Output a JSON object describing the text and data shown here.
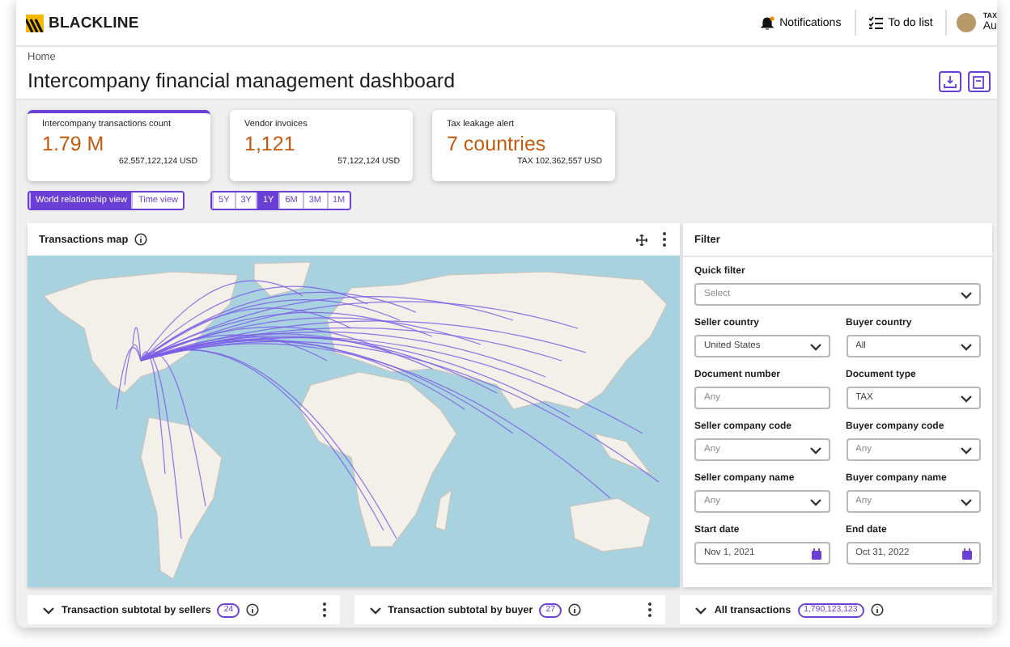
{
  "header": {
    "brand": "BLACKLINE",
    "notifications": "Notifications",
    "todo": "To do list",
    "user_role": "TAX",
    "user_name": "Au"
  },
  "breadcrumb": "Home",
  "title": "Intercompany financial management dashboard",
  "kpis": [
    {
      "label": "Intercompany transactions count",
      "value": "1.79 M",
      "sub": "62,557,122,124 USD",
      "selected": true
    },
    {
      "label": "Vendor invoices",
      "value": "1,121",
      "sub": "57,122,124 USD",
      "selected": false
    },
    {
      "label": "Tax leakage alert",
      "value": "7 countries",
      "sub": "TAX 102,362,557 USD",
      "selected": false
    }
  ],
  "views": [
    {
      "label": "World relationship view",
      "selected": true
    },
    {
      "label": "Time view",
      "selected": false
    }
  ],
  "ranges": [
    {
      "label": "5Y",
      "selected": false
    },
    {
      "label": "3Y",
      "selected": false
    },
    {
      "label": "1Y",
      "selected": true
    },
    {
      "label": "6M",
      "selected": false
    },
    {
      "label": "3M",
      "selected": false
    },
    {
      "label": "1M",
      "selected": false
    }
  ],
  "map": {
    "title": "Transactions map"
  },
  "filter": {
    "title": "Filter",
    "rows": [
      [
        {
          "label": "Quick filter",
          "kind": "select",
          "placeholder": "Select"
        }
      ],
      [
        {
          "label": "Seller country",
          "kind": "select",
          "value": "United States"
        },
        {
          "label": "Buyer country",
          "kind": "select",
          "value": "All"
        }
      ],
      [
        {
          "label": "Document number",
          "kind": "text",
          "placeholder": "Any"
        },
        {
          "label": "Document type",
          "kind": "select",
          "value": "TAX"
        }
      ],
      [
        {
          "label": "Seller company code",
          "kind": "select",
          "placeholder": "Any"
        },
        {
          "label": "Buyer company code",
          "kind": "select",
          "placeholder": "Any"
        }
      ],
      [
        {
          "label": "Seller company name",
          "kind": "select",
          "placeholder": "Any"
        },
        {
          "label": "Buyer company name",
          "kind": "select",
          "placeholder": "Any"
        }
      ],
      [
        {
          "label": "Start date",
          "kind": "date",
          "value": "Nov 1, 2021"
        },
        {
          "label": "End date",
          "kind": "date",
          "value": "Oct 31, 2022"
        }
      ]
    ]
  },
  "bottom_panels": [
    {
      "title": "Transaction subtotal by sellers",
      "count": "24",
      "menu": true
    },
    {
      "title": "Transaction subtotal by buyer",
      "count": "27",
      "menu": true
    },
    {
      "title": "All transactions",
      "count": "1,790,123,123",
      "menu": false
    }
  ]
}
